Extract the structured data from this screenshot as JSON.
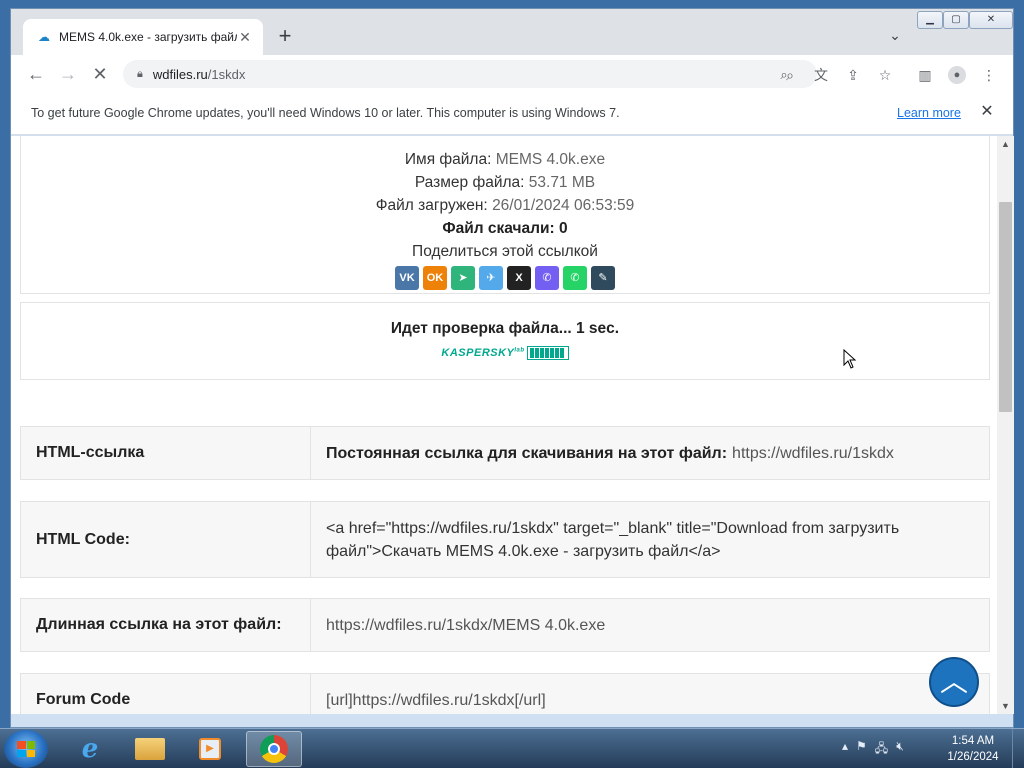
{
  "browser": {
    "tab_title": "MEMS 4.0k.exe - загрузить файл",
    "tab_close": "✕",
    "new_tab": "+",
    "url_host": "wdfiles.ru",
    "url_path": "/1skdx"
  },
  "infobar": {
    "message": "To get future Google Chrome updates, you'll need Windows 10 or later. This computer is using Windows 7.",
    "link": "Learn more",
    "close": "✕"
  },
  "file": {
    "name_label": "Имя файла:",
    "name_value": "MEMS 4.0k.exe",
    "size_label": "Размер файла:",
    "size_value": "53.71 MB",
    "uploaded_label": "Файл загружен:",
    "uploaded_value": "26/01/2024 06:53:59",
    "downloads": "Файл скачали: 0",
    "share_label": "Поделиться этой ссылкой"
  },
  "share_icons": [
    {
      "name": "vk-icon",
      "glyph": "VK",
      "color": "#4a76a8"
    },
    {
      "name": "odnoklassniki-icon",
      "glyph": "OK",
      "color": "#ee8208"
    },
    {
      "name": "mail-share-icon",
      "glyph": "➤",
      "color": "#2fb47c"
    },
    {
      "name": "telegram-icon",
      "glyph": "✈",
      "color": "#54a9eb"
    },
    {
      "name": "x-twitter-icon",
      "glyph": "X",
      "color": "#222222"
    },
    {
      "name": "viber-icon",
      "glyph": "✆",
      "color": "#7360f2"
    },
    {
      "name": "whatsapp-icon",
      "glyph": "✆",
      "color": "#25d366"
    },
    {
      "name": "livejournal-icon",
      "glyph": "✎",
      "color": "#2f4a5c"
    }
  ],
  "check": {
    "text": "Идет проверка файла... 1 sec.",
    "vendor": "KASPERSKY",
    "vendor_mark": "lab",
    "progress": 1.0
  },
  "rows": [
    {
      "label": "HTML-ссылка",
      "strong": "Постоянная ссылка для скачивания на этот файл:",
      "value": "https://wdfiles.ru/1skdx"
    },
    {
      "label": "HTML Code:",
      "strong": "",
      "value": "<a href=\"https://wdfiles.ru/1skdx\" target=\"_blank\" title=\"Download from загрузить файл\">Скачать MEMS 4.0k.exe - загрузить файл</a>"
    },
    {
      "label": "Длинная ссылка на этот файл:",
      "strong": "",
      "value": "https://wdfiles.ru/1skdx/MEMS 4.0k.exe"
    },
    {
      "label": "Forum Code",
      "strong": "",
      "value": "[url]https://wdfiles.ru/1skdx[/url]"
    }
  ],
  "taskbar": {
    "time": "1:54 AM",
    "date": "1/26/2024"
  }
}
